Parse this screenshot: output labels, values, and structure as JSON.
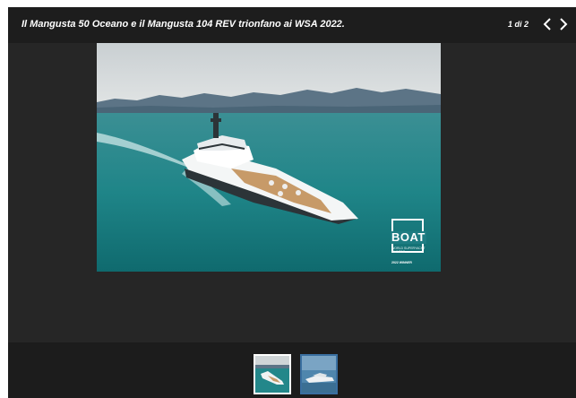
{
  "header": {
    "caption": "Il Mangusta 50 Oceano e il Mangusta 104 REV trionfano ai WSA 2022.",
    "counter": "1 di 2",
    "prev_icon": "chevron-left-icon",
    "next_icon": "chevron-right-icon"
  },
  "photo": {
    "subject": "yacht-at-sea",
    "badge": {
      "title": "BOAT",
      "subtitle": "World Superyacht Awards",
      "year": "2022 Winner"
    }
  },
  "thumbnails": [
    {
      "selected": true
    },
    {
      "selected": false
    }
  ],
  "colors": {
    "viewer_bg": "#262626",
    "topbar_bg": "#1d1d1d",
    "thumbbar_bg": "#1c1c1c",
    "sea": "#2a8c8f",
    "text": "#ffffff"
  }
}
